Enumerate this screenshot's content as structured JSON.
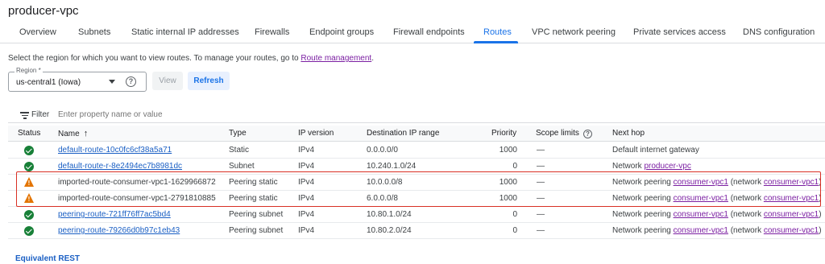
{
  "page_title": "producer-vpc",
  "tabs": [
    {
      "label": "Overview"
    },
    {
      "label": "Subnets"
    },
    {
      "label": "Static internal IP addresses"
    },
    {
      "label": "Firewalls"
    },
    {
      "label": "Endpoint groups"
    },
    {
      "label": "Firewall endpoints"
    },
    {
      "label": "Routes"
    },
    {
      "label": "VPC network peering"
    },
    {
      "label": "Private services access"
    },
    {
      "label": "DNS configuration"
    }
  ],
  "active_tab": "Routes",
  "intro": {
    "text": "Select the region for which you want to view routes. To manage your routes, go to ",
    "link": "Route management",
    "suffix": "."
  },
  "region": {
    "label": "Region *",
    "value": "us-central1 (Iowa)"
  },
  "buttons": {
    "view": "View",
    "refresh": "Refresh"
  },
  "filter": {
    "label": "Filter",
    "placeholder": "Enter property name or value"
  },
  "table": {
    "headers": {
      "status": "Status",
      "name": "Name",
      "type": "Type",
      "ip_version": "IP version",
      "dest": "Destination IP range",
      "priority": "Priority",
      "scope": "Scope limits",
      "next_hop": "Next hop"
    },
    "rows": [
      {
        "status": "ok",
        "name": "default-route-10c0fc6cf38a5a71",
        "type": "Static",
        "ip": "IPv4",
        "dest": "0.0.0.0/0",
        "priority": "1000",
        "scope": "—",
        "hop_text": "Default internet gateway"
      },
      {
        "status": "ok",
        "name": "default-route-r-8e2494ec7b8981dc",
        "type": "Subnet",
        "ip": "IPv4",
        "dest": "10.240.1.0/24",
        "priority": "0",
        "scope": "—",
        "hop_prefix": "Network ",
        "hop_link": "producer-vpc"
      },
      {
        "status": "warn",
        "name": "imported-route-consumer-vpc1-1629966872",
        "type": "Peering static",
        "ip": "IPv4",
        "dest": "10.0.0.0/8",
        "priority": "1000",
        "scope": "—",
        "hop_prefix": "Network peering ",
        "hop_link": "consumer-vpc1",
        "hop_mid": " (network ",
        "hop_link2": "consumer-vpc1",
        "hop_suffix": ")"
      },
      {
        "status": "warn",
        "name": "imported-route-consumer-vpc1-2791810885",
        "type": "Peering static",
        "ip": "IPv4",
        "dest": "6.0.0.0/8",
        "priority": "1000",
        "scope": "—",
        "hop_prefix": "Network peering ",
        "hop_link": "consumer-vpc1",
        "hop_mid": " (network ",
        "hop_link2": "consumer-vpc1",
        "hop_suffix": ")"
      },
      {
        "status": "ok",
        "name": "peering-route-721ff76ff7ac5bd4",
        "type": "Peering subnet",
        "ip": "IPv4",
        "dest": "10.80.1.0/24",
        "priority": "0",
        "scope": "—",
        "hop_prefix": "Network peering ",
        "hop_link": "consumer-vpc1",
        "hop_mid": " (network ",
        "hop_link2": "consumer-vpc1",
        "hop_suffix": ")"
      },
      {
        "status": "ok",
        "name": "peering-route-79266d0b97c1eb43",
        "type": "Peering subnet",
        "ip": "IPv4",
        "dest": "10.80.2.0/24",
        "priority": "0",
        "scope": "—",
        "hop_prefix": "Network peering ",
        "hop_link": "consumer-vpc1",
        "hop_mid": " (network ",
        "hop_link2": "consumer-vpc1",
        "hop_suffix": ")"
      }
    ]
  },
  "footer_link": "Equivalent REST",
  "colors": {
    "accent": "#1a73e8",
    "link_visited": "#7b1fa2",
    "ok": "#188038",
    "warn": "#e37400",
    "highlight": "#d93025"
  }
}
